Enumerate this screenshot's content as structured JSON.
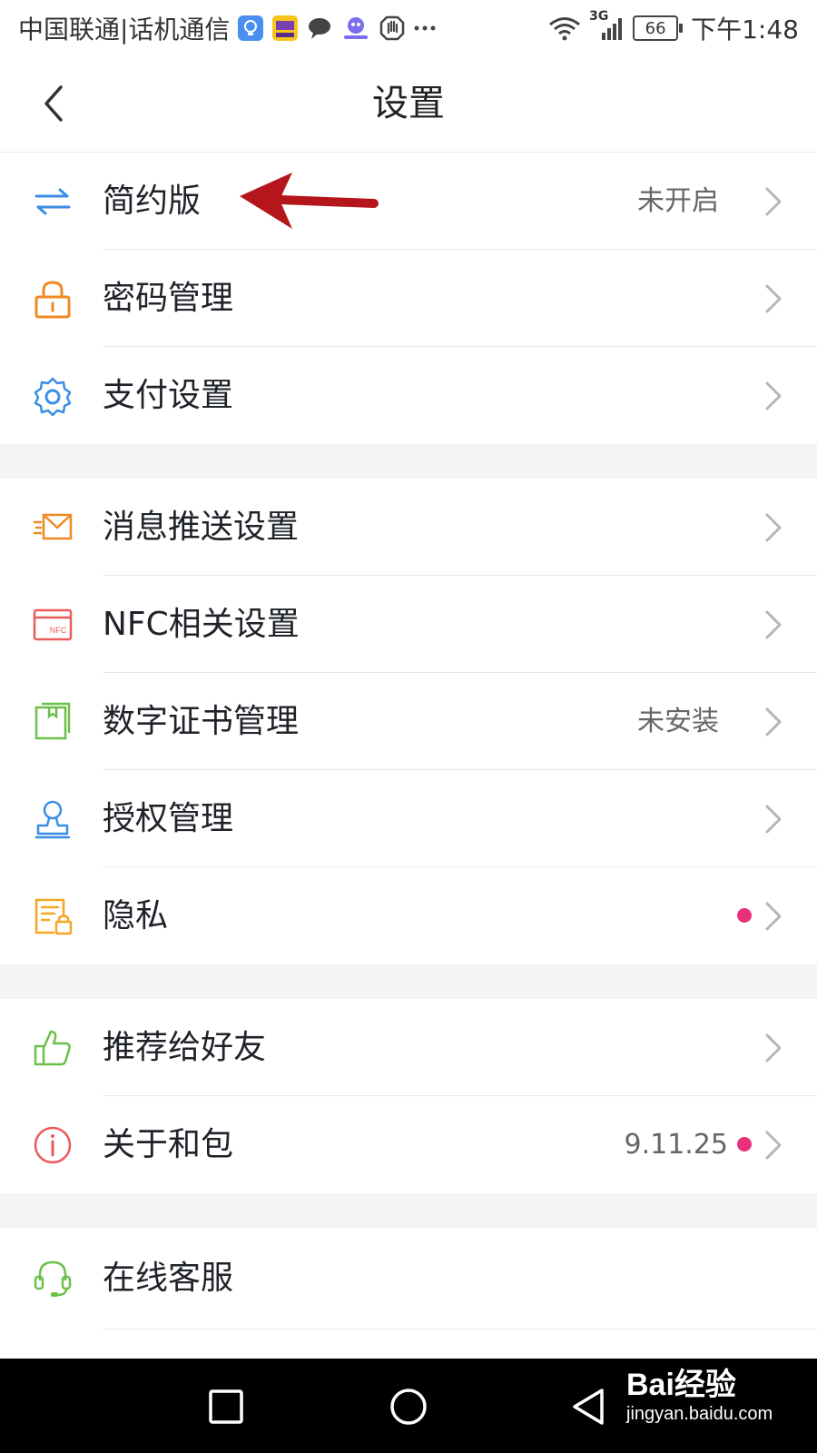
{
  "status_bar": {
    "carrier": "中国联通|话机通信",
    "network": "3G",
    "battery": "66",
    "time": "下午1:48",
    "app_icons": [
      "bulb-icon",
      "app-badge-icon",
      "chat-bubble-icon",
      "robot-icon",
      "hand-icon",
      "more-dots-icon"
    ]
  },
  "header": {
    "title": "设置"
  },
  "sections": [
    {
      "items": [
        {
          "name": "simple-mode",
          "label": "简约版",
          "value": "未开启",
          "dot": false,
          "icon": "swap-arrows-icon",
          "icon_color": "#3a8ee6"
        },
        {
          "name": "password-management",
          "label": "密码管理",
          "value": "",
          "dot": false,
          "icon": "lock-icon",
          "icon_color": "#f08a24"
        },
        {
          "name": "payment-settings",
          "label": "支付设置",
          "value": "",
          "dot": false,
          "icon": "gear-icon",
          "icon_color": "#3a8ee6"
        }
      ]
    },
    {
      "items": [
        {
          "name": "push-settings",
          "label": "消息推送设置",
          "value": "",
          "dot": false,
          "icon": "envelope-icon",
          "icon_color": "#f08a24"
        },
        {
          "name": "nfc-settings",
          "label": "NFC相关设置",
          "value": "",
          "dot": false,
          "icon": "nfc-card-icon",
          "icon_color": "#ec5b5b",
          "icon_text": "NFC"
        },
        {
          "name": "certificate-management",
          "label": "数字证书管理",
          "value": "未安装",
          "dot": false,
          "icon": "certificate-icon",
          "icon_color": "#6cc04a"
        },
        {
          "name": "authorization-management",
          "label": "授权管理",
          "value": "",
          "dot": false,
          "icon": "stamp-icon",
          "icon_color": "#3a8ee6"
        },
        {
          "name": "privacy",
          "label": "隐私",
          "value": "",
          "dot": true,
          "icon": "document-lock-icon",
          "icon_color": "#f5a623"
        }
      ]
    },
    {
      "items": [
        {
          "name": "recommend-friends",
          "label": "推荐给好友",
          "value": "",
          "dot": false,
          "icon": "thumbs-up-icon",
          "icon_color": "#6cc04a"
        },
        {
          "name": "about",
          "label": "关于和包",
          "value": "9.11.25",
          "dot": true,
          "icon": "info-icon",
          "icon_color": "#ec5b5b"
        }
      ]
    },
    {
      "items": [
        {
          "name": "online-service",
          "label": "在线客服",
          "value": "",
          "dot": false,
          "icon": "headset-icon",
          "icon_color": "#6cc04a",
          "chevron": false
        }
      ]
    }
  ],
  "colors": {
    "dot": "#e8317a",
    "section_gap": "#f3f4f6",
    "chevron": "#b5b5b5",
    "annotation_arrow": "#b5161c"
  },
  "annotation": {
    "icon": "red-arrow-icon"
  },
  "nav_bar": {
    "buttons": [
      "recent-apps-button",
      "home-button",
      "back-nav-button"
    ]
  },
  "watermark": {
    "brand": "Bai经验",
    "url": "jingyan.baidu.com"
  }
}
